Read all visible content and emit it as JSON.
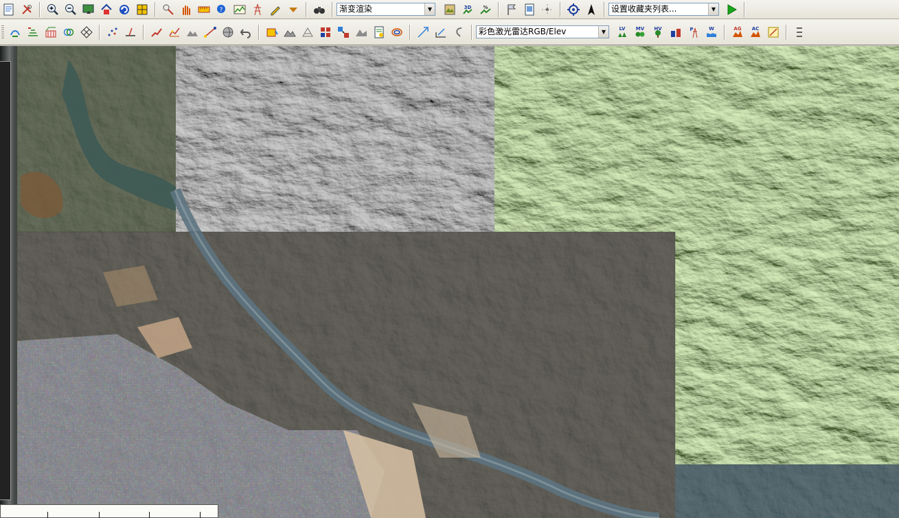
{
  "toolbar1": {
    "render_mode": {
      "value": "渐变渲染"
    },
    "favorites": {
      "value": "设置收藏夹列表..."
    }
  },
  "toolbar2": {
    "layer_style": {
      "value": "彩色激光雷达RGB/Elev"
    },
    "icon_labels": {
      "lv": "LV",
      "mv": "MV",
      "hv": "HV",
      "p": "P",
      "w": "W",
      "ag": "AG",
      "ac": "AC",
      "d3": "3D",
      "pct": "%"
    }
  },
  "colors": {
    "toolbar_bg": "#ece9d8",
    "go_arrow": "#17a81a",
    "combo_border": "#7f9db9"
  },
  "map": {
    "tiles": [
      "dark-green-reservoir-imagery",
      "grayscale-mountain-imagery",
      "green-shaded-relief-imagery",
      "city-river-valley-imagery",
      "blue-forest-imagery"
    ]
  }
}
